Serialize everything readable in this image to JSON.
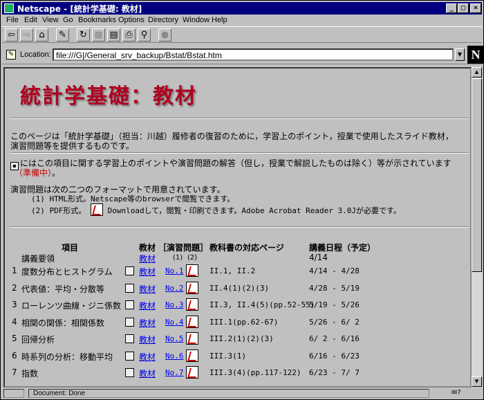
{
  "window": {
    "title": "Netscape - [統計学基礎: 教材]",
    "minimize": "_",
    "maximize": "□",
    "close": "×"
  },
  "menu": [
    "File",
    "Edit",
    "View",
    "Go",
    "Bookmarks",
    "Options",
    "Directory",
    "Window",
    "Help"
  ],
  "location": {
    "label": "Location:",
    "url": "file:///G|/General_srv_backup/Bstat/Bstat.htm",
    "logo": "N"
  },
  "page": {
    "heading": "統計学基礎：教材",
    "intro_line1": "このページは「統計学基礎」（担当：川越）履修者の復習のために，学習上のポイント，授業で使用したスライド教材，",
    "intro_line2": "演習問題等を提供するものです。",
    "icon_note": "にはこの項目に関する学習上のポイントや演習問題の解答（但し，授業で解説したものは除く）等が示されています",
    "icon_note_status": "（準備中）",
    "icon_note_end": "。",
    "formats_intro": "演習問題は次の二つのフォーマットで用意されています。",
    "format1": "(1) HTML形式。Netscape等のbrowserで閲覧できます。",
    "format2_pre": "(2) PDF形式。",
    "format2_post": "Downloadして，閲覧・印刷できます。Adobe Acrobat Reader 3.0Jが必要です。"
  },
  "table": {
    "headers": {
      "item": "項目",
      "material": "教材",
      "exercises": "［演習問題］",
      "textbook": "教科書の対応ページ",
      "schedule": "講義日程（予定）"
    },
    "subheaders": {
      "fmt1": "(1)",
      "fmt2": "(2)"
    },
    "syllabus": {
      "label": "講義要領",
      "material": "教材",
      "date": "4/14"
    },
    "rows": [
      {
        "num": "1",
        "topic": "度数分布とヒストグラム",
        "material": "教材",
        "exercise": "No.1",
        "pages": "II.1, II.2",
        "dates": "4/14 - 4/28"
      },
      {
        "num": "2",
        "topic": "代表値：平均・分散等",
        "material": "教材",
        "exercise": "No.2",
        "pages": "II.4(1)(2)(3)",
        "dates": "4/28 - 5/19"
      },
      {
        "num": "3",
        "topic": "ローレンツ曲線・ジニ係数",
        "material": "教材",
        "exercise": "No.3",
        "pages": "II.3, II.4(5)(pp.52-55)",
        "dates": "5/19 - 5/26"
      },
      {
        "num": "4",
        "topic": "相関の関係：相関係数",
        "material": "教材",
        "exercise": "No.4",
        "pages": "III.1(pp.62-67)",
        "dates": "5/26 - 6/ 2"
      },
      {
        "num": "5",
        "topic": "回帰分析",
        "material": "教材",
        "exercise": "No.5",
        "pages": "III.2(1)(2)(3)",
        "dates": "6/ 2 - 6/16"
      },
      {
        "num": "6",
        "topic": "時系列の分析：移動平均",
        "material": "教材",
        "exercise": "No.6",
        "pages": "III.3(1)",
        "dates": "6/16 - 6/23"
      },
      {
        "num": "7",
        "topic": "指数",
        "material": "教材",
        "exercise": "No.7",
        "pages": "III.3(4)(pp.117-122)",
        "dates": "6/23 - 7/ 7"
      }
    ]
  },
  "status": {
    "text": "Document: Done"
  },
  "colors": {
    "title_bar": "#000080",
    "heading": "#b00020",
    "link": "#0000ee",
    "note_red": "#c00000"
  }
}
